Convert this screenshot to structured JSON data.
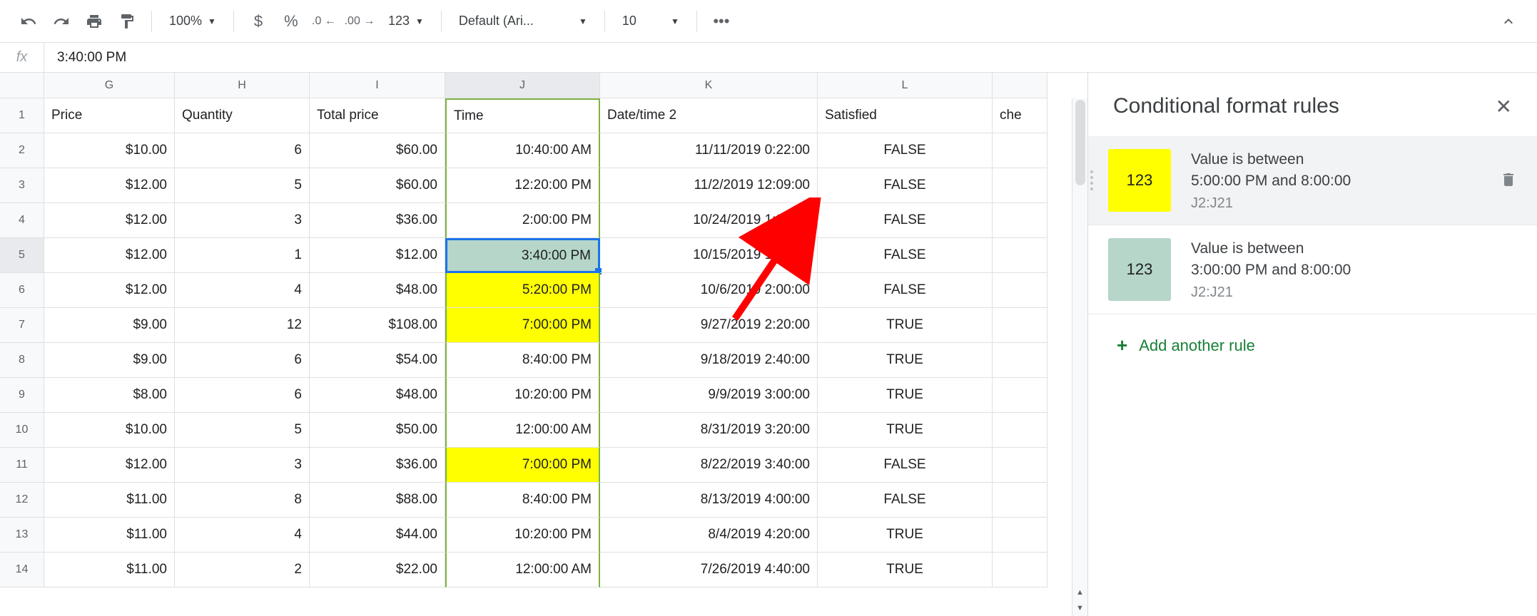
{
  "toolbar": {
    "zoom": "100%",
    "format_123": "123",
    "font": "Default (Ari...",
    "font_size": "10"
  },
  "formula_bar": {
    "value": "3:40:00 PM"
  },
  "columns": [
    "G",
    "H",
    "I",
    "J",
    "K",
    "L",
    ""
  ],
  "row_numbers": [
    "1",
    "2",
    "3",
    "4",
    "5",
    "6",
    "7",
    "8",
    "9",
    "10",
    "11",
    "12",
    "13",
    "14"
  ],
  "headers": {
    "G": "Price",
    "H": "Quantity",
    "I": "Total price",
    "J": "Time",
    "K": "Date/time 2",
    "L": "Satisfied",
    "M": "che"
  },
  "rows": [
    {
      "G": "$10.00",
      "H": "6",
      "I": "$60.00",
      "J": "10:40:00 AM",
      "K": "11/11/2019 0:22:00",
      "L": "FALSE",
      "jfmt": ""
    },
    {
      "G": "$12.00",
      "H": "5",
      "I": "$60.00",
      "J": "12:20:00 PM",
      "K": "11/2/2019 12:09:00",
      "L": "FALSE",
      "jfmt": ""
    },
    {
      "G": "$12.00",
      "H": "3",
      "I": "$36.00",
      "J": "2:00:00 PM",
      "K": "10/24/2019 1:20:00",
      "L": "FALSE",
      "jfmt": ""
    },
    {
      "G": "$12.00",
      "H": "1",
      "I": "$12.00",
      "J": "3:40:00 PM",
      "K": "10/15/2019 1:40:00",
      "L": "FALSE",
      "jfmt": "sel"
    },
    {
      "G": "$12.00",
      "H": "4",
      "I": "$48.00",
      "J": "5:20:00 PM",
      "K": "10/6/2019 2:00:00",
      "L": "FALSE",
      "jfmt": "yellow"
    },
    {
      "G": "$9.00",
      "H": "12",
      "I": "$108.00",
      "J": "7:00:00 PM",
      "K": "9/27/2019 2:20:00",
      "L": "TRUE",
      "jfmt": "yellow"
    },
    {
      "G": "$9.00",
      "H": "6",
      "I": "$54.00",
      "J": "8:40:00 PM",
      "K": "9/18/2019 2:40:00",
      "L": "TRUE",
      "jfmt": ""
    },
    {
      "G": "$8.00",
      "H": "6",
      "I": "$48.00",
      "J": "10:20:00 PM",
      "K": "9/9/2019 3:00:00",
      "L": "TRUE",
      "jfmt": ""
    },
    {
      "G": "$10.00",
      "H": "5",
      "I": "$50.00",
      "J": "12:00:00 AM",
      "K": "8/31/2019 3:20:00",
      "L": "TRUE",
      "jfmt": ""
    },
    {
      "G": "$12.00",
      "H": "3",
      "I": "$36.00",
      "J": "7:00:00 PM",
      "K": "8/22/2019 3:40:00",
      "L": "FALSE",
      "jfmt": "yellow"
    },
    {
      "G": "$11.00",
      "H": "8",
      "I": "$88.00",
      "J": "8:40:00 PM",
      "K": "8/13/2019 4:00:00",
      "L": "FALSE",
      "jfmt": ""
    },
    {
      "G": "$11.00",
      "H": "4",
      "I": "$44.00",
      "J": "10:20:00 PM",
      "K": "8/4/2019 4:20:00",
      "L": "TRUE",
      "jfmt": ""
    },
    {
      "G": "$11.00",
      "H": "2",
      "I": "$22.00",
      "J": "12:00:00 AM",
      "K": "7/26/2019 4:40:00",
      "L": "TRUE",
      "jfmt": ""
    }
  ],
  "sidebar": {
    "title": "Conditional format rules",
    "swatch_label": "123",
    "rules": [
      {
        "title_l1": "Value is between",
        "title_l2": "5:00:00 PM and 8:00:00",
        "range": "J2:J21",
        "color": "yellow"
      },
      {
        "title_l1": "Value is between",
        "title_l2": "3:00:00 PM and 8:00:00",
        "range": "J2:J21",
        "color": "green"
      }
    ],
    "add_label": "Add another rule"
  }
}
